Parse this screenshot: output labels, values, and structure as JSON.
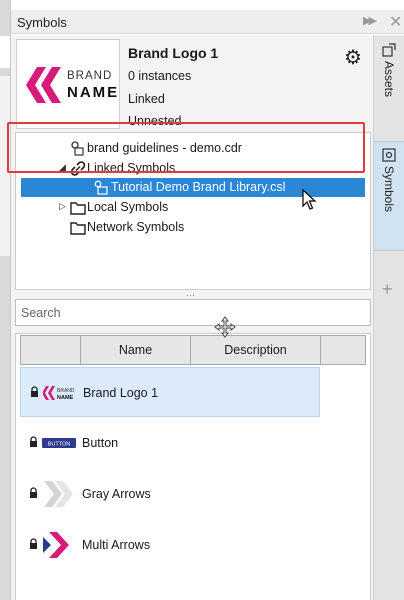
{
  "panel": {
    "title": "Symbols",
    "collapse_icon": "double-chevron-right-icon",
    "close_icon": "close-icon"
  },
  "side_tabs": [
    {
      "label": "Assets",
      "icon": "assets-icon"
    },
    {
      "label": "Symbols",
      "icon": "symbols-icon",
      "active": true
    }
  ],
  "add_tab_icon": "plus-icon",
  "selected_symbol": {
    "name": "Brand Logo 1",
    "instances": "0 instances",
    "link_status": "Linked",
    "nest_status": "Unnested",
    "thumb_brand": "BRAND",
    "thumb_name": "NAME"
  },
  "tree": {
    "items": [
      {
        "label": "brand guidelines - demo.cdr",
        "icon": "document-link-icon"
      },
      {
        "label": "Linked Symbols",
        "icon": "link-icon",
        "expanded": true
      },
      {
        "label": "Tutorial Demo Brand Library.csl",
        "icon": "library-link-icon",
        "selected": true
      },
      {
        "label": "Local Symbols",
        "icon": "folder-icon",
        "expanded": false
      },
      {
        "label": "Network Symbols",
        "icon": "folder-icon"
      }
    ]
  },
  "search": {
    "placeholder": "Search",
    "value": ""
  },
  "list": {
    "columns": [
      "",
      "Name",
      "Description",
      ""
    ],
    "rows": [
      {
        "name": "Brand Logo 1",
        "preview": "brand-logo-preview",
        "locked": true,
        "selected": true,
        "preview_line1": "BRAND",
        "preview_line2": "NAME"
      },
      {
        "name": "Button",
        "preview": "button-preview",
        "locked": true,
        "preview_text": "BUTTON"
      },
      {
        "name": "Gray Arrows",
        "preview": "gray-arrows-preview",
        "locked": true
      },
      {
        "name": "Multi Arrows",
        "preview": "multi-arrows-preview",
        "locked": true
      }
    ]
  },
  "colors": {
    "selection_blue": "#2b86d6",
    "highlight_red": "#e0393e",
    "brand_magenta": "#d81b7a",
    "button_navy": "#2e3a8c"
  }
}
